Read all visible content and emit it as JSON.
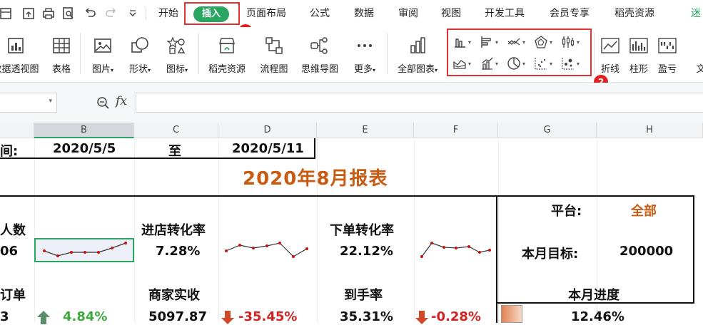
{
  "menu": {
    "tabs": [
      "开始",
      "插入",
      "页面布局",
      "公式",
      "数据",
      "审阅",
      "视图",
      "开发工具",
      "会员专享",
      "稻壳资源",
      "迷"
    ],
    "active_tab": "插入",
    "step_badges": [
      "1",
      "2"
    ]
  },
  "ribbon": {
    "items": [
      "数据透视图",
      "表格",
      "图片",
      "形状",
      "图标",
      "稻壳资源",
      "流程图",
      "思维导图",
      "更多",
      "全部图表",
      "折线",
      "柱形",
      "盈亏",
      "文"
    ],
    "chart_type_icons": [
      "column-chart-icon",
      "bar-chart-icon",
      "line-chart-icon",
      "radar-chart-icon",
      "stock-chart-icon",
      "area-chart-icon",
      "combo-chart-icon",
      "pie-chart-icon",
      "scatter-chart-icon",
      "bubble-chart-icon"
    ]
  },
  "formula_bar": {
    "fx_label": "fx",
    "value": ""
  },
  "columns": [
    "B",
    "C",
    "D",
    "E",
    "F",
    "G",
    "H"
  ],
  "selected_column": "B",
  "sheet": {
    "period_label": "间:",
    "start_date": "2020/5/5",
    "to_label": "至",
    "end_date": "2020/5/11",
    "title": "2020年8月报表",
    "kpi1_label": "人数",
    "kpi1_value": "06",
    "kpi2_label": "进店转化率",
    "kpi2_value": "7.28%",
    "kpi3_label": "下单转化率",
    "kpi3_value": "22.12%",
    "kpi4_label": "订单",
    "kpi4_value": "3",
    "kpi4_change": "4.84%",
    "kpi5_label": "商家实收",
    "kpi5_value": "5097.87",
    "kpi5_change": "-35.45%",
    "kpi6_label": "到手率",
    "kpi6_value": "35.31%",
    "kpi6_change": "-0.28%",
    "platform_label": "平台:",
    "platform_value": "全部",
    "target_label": "本月目标:",
    "target_value": "200000",
    "progress_label": "本月进度",
    "progress_value": "12.46%",
    "progress_fraction": 0.1246
  },
  "colors": {
    "accent_green": "#2aa663",
    "title_orange": "#c85a12",
    "highlight_red": "#e03030",
    "up_green": "#3daa3d",
    "down_red": "#d22222"
  }
}
